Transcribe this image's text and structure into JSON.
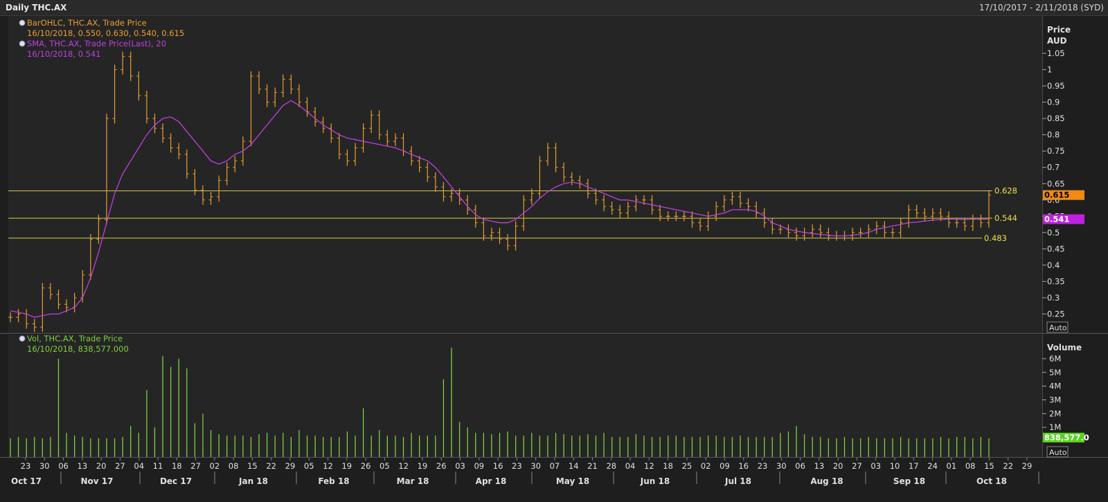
{
  "window": {
    "title": "Daily THC.AX",
    "date_range": "17/10/2017 - 2/11/2018 (SYD)"
  },
  "legend_price": [
    {
      "label": "BarOHLC, THC.AX, Trade Price",
      "value": "16/10/2018, 0.550, 0.630, 0.540, 0.615",
      "color": "#e8a030"
    },
    {
      "label": "SMA, THC.AX, Trade Price(Last), 20",
      "value": "16/10/2018, 0.541",
      "color": "#c040e0"
    }
  ],
  "legend_volume": {
    "label": "Vol, THC.AX, Trade Price",
    "value": "16/10/2018, 838,577.000",
    "color": "#7fd040"
  },
  "price_axis": {
    "title_1": "Price",
    "title_2": "AUD",
    "ticks": [
      "1.05",
      "1",
      "0.95",
      "0.9",
      "0.85",
      "0.8",
      "0.75",
      "0.7",
      "0.65",
      "0.6",
      "0.55",
      "0.5",
      "0.45",
      "0.4",
      "0.35",
      "0.3",
      "0.25"
    ],
    "auto_label": "Auto"
  },
  "volume_axis": {
    "title": "Volume",
    "ticks": [
      "6M",
      "5M",
      "4M",
      "3M",
      "2M",
      "1M"
    ],
    "auto_label": "Auto",
    "last_value": "838,577.0"
  },
  "markers": {
    "last_price": "0.615",
    "last_sma": "0.541"
  },
  "chart_data": {
    "type": "line",
    "x_day_ticks": [
      "23",
      "30",
      "06",
      "13",
      "20",
      "27",
      "04",
      "11",
      "18",
      "27",
      "02",
      "08",
      "15",
      "22",
      "29",
      "05",
      "12",
      "19",
      "26",
      "05",
      "12",
      "19",
      "26",
      "03",
      "09",
      "16",
      "23",
      "30",
      "07",
      "14",
      "21",
      "28",
      "04",
      "12",
      "18",
      "25",
      "02",
      "09",
      "16",
      "23",
      "30",
      "06",
      "13",
      "20",
      "27",
      "03",
      "10",
      "17",
      "24",
      "01",
      "08",
      "15",
      "22",
      "29"
    ],
    "x_month_labels": [
      "Oct 17",
      "Nov 17",
      "Dec 17",
      "Jan 18",
      "Feb 18",
      "Mar 18",
      "Apr 18",
      "May 18",
      "Jun 18",
      "Jul 18",
      "Aug 18",
      "Sep 18",
      "Oct 18"
    ],
    "ylim": [
      0.2,
      1.1
    ],
    "volume_ylim": [
      0,
      6.8
    ],
    "horizontal_lines": [
      {
        "label": "0.628",
        "value": 0.628
      },
      {
        "label": "0.544",
        "value": 0.544
      },
      {
        "label": "0.483",
        "value": 0.483
      }
    ],
    "series": [
      {
        "name": "BarOHLC, THC.AX, Trade Price",
        "kind": "ohlc_close",
        "values": [
          0.24,
          0.25,
          0.22,
          0.21,
          0.33,
          0.31,
          0.28,
          0.27,
          0.3,
          0.37,
          0.48,
          0.54,
          0.85,
          1.0,
          1.04,
          0.98,
          0.92,
          0.85,
          0.82,
          0.79,
          0.76,
          0.74,
          0.68,
          0.63,
          0.6,
          0.61,
          0.66,
          0.7,
          0.72,
          0.78,
          0.98,
          0.94,
          0.9,
          0.93,
          0.97,
          0.94,
          0.9,
          0.87,
          0.84,
          0.82,
          0.79,
          0.74,
          0.72,
          0.76,
          0.82,
          0.86,
          0.8,
          0.78,
          0.79,
          0.75,
          0.72,
          0.7,
          0.67,
          0.64,
          0.61,
          0.62,
          0.6,
          0.57,
          0.53,
          0.49,
          0.5,
          0.48,
          0.46,
          0.52,
          0.6,
          0.62,
          0.72,
          0.76,
          0.7,
          0.67,
          0.66,
          0.65,
          0.62,
          0.6,
          0.58,
          0.57,
          0.56,
          0.58,
          0.6,
          0.6,
          0.57,
          0.55,
          0.55,
          0.55,
          0.55,
          0.53,
          0.52,
          0.55,
          0.58,
          0.6,
          0.61,
          0.59,
          0.58,
          0.56,
          0.53,
          0.51,
          0.51,
          0.5,
          0.49,
          0.5,
          0.51,
          0.5,
          0.49,
          0.49,
          0.49,
          0.5,
          0.5,
          0.51,
          0.52,
          0.5,
          0.5,
          0.53,
          0.57,
          0.56,
          0.55,
          0.56,
          0.55,
          0.53,
          0.53,
          0.52,
          0.54,
          0.53,
          0.615
        ]
      },
      {
        "name": "SMA, THC.AX, Trade Price(Last), 20",
        "kind": "sma",
        "values": [
          0.26,
          0.255,
          0.25,
          0.24,
          0.245,
          0.25,
          0.25,
          0.26,
          0.27,
          0.3,
          0.36,
          0.44,
          0.53,
          0.62,
          0.68,
          0.72,
          0.76,
          0.8,
          0.83,
          0.85,
          0.855,
          0.84,
          0.81,
          0.78,
          0.75,
          0.72,
          0.71,
          0.72,
          0.74,
          0.75,
          0.77,
          0.8,
          0.83,
          0.86,
          0.89,
          0.905,
          0.89,
          0.87,
          0.85,
          0.83,
          0.815,
          0.8,
          0.79,
          0.785,
          0.78,
          0.775,
          0.77,
          0.765,
          0.76,
          0.75,
          0.74,
          0.73,
          0.72,
          0.7,
          0.67,
          0.64,
          0.61,
          0.58,
          0.555,
          0.54,
          0.535,
          0.53,
          0.53,
          0.54,
          0.56,
          0.58,
          0.605,
          0.625,
          0.64,
          0.65,
          0.655,
          0.65,
          0.64,
          0.63,
          0.62,
          0.61,
          0.6,
          0.6,
          0.595,
          0.59,
          0.585,
          0.58,
          0.575,
          0.57,
          0.565,
          0.56,
          0.555,
          0.55,
          0.555,
          0.56,
          0.57,
          0.57,
          0.57,
          0.565,
          0.55,
          0.53,
          0.52,
          0.51,
          0.505,
          0.5,
          0.497,
          0.494,
          0.492,
          0.49,
          0.49,
          0.492,
          0.495,
          0.5,
          0.51,
          0.515,
          0.52,
          0.525,
          0.53,
          0.532,
          0.535,
          0.538,
          0.54,
          0.541,
          0.541,
          0.54,
          0.541,
          0.541,
          0.541
        ]
      },
      {
        "name": "Vol, THC.AX, Trade Price",
        "kind": "volume",
        "values": [
          0.2,
          0.3,
          0.2,
          0.3,
          0.2,
          0.3,
          6.0,
          0.6,
          0.4,
          0.3,
          0.2,
          0.2,
          0.2,
          0.2,
          0.3,
          1.1,
          0.6,
          3.7,
          1.0,
          6.2,
          5.4,
          6.0,
          5.3,
          1.3,
          2.0,
          0.8,
          0.5,
          0.4,
          0.4,
          0.4,
          0.3,
          0.5,
          0.6,
          0.4,
          0.6,
          0.3,
          0.8,
          0.4,
          0.4,
          0.3,
          0.3,
          0.3,
          0.7,
          0.4,
          2.4,
          0.4,
          0.8,
          0.4,
          0.4,
          0.3,
          0.6,
          0.4,
          0.4,
          0.4,
          4.5,
          6.8,
          1.4,
          1.0,
          0.6,
          0.6,
          0.5,
          0.6,
          0.7,
          0.4,
          0.4,
          0.6,
          0.4,
          0.4,
          0.6,
          0.5,
          0.4,
          0.4,
          0.5,
          0.4,
          0.6,
          0.3,
          0.3,
          0.3,
          0.5,
          0.4,
          0.3,
          0.3,
          0.4,
          0.4,
          0.3,
          0.3,
          0.3,
          0.4,
          0.4,
          0.3,
          0.3,
          0.4,
          0.3,
          0.3,
          0.3,
          0.3,
          0.6,
          0.7,
          1.1,
          0.5,
          0.3,
          0.3,
          0.2,
          0.2,
          0.3,
          0.2,
          0.2,
          0.3,
          0.2,
          0.2,
          0.2,
          0.3,
          0.2,
          0.2,
          0.2,
          0.2,
          0.3,
          0.2,
          0.3,
          0.3,
          0.2,
          0.3,
          0.2,
          0.8
        ]
      }
    ]
  }
}
